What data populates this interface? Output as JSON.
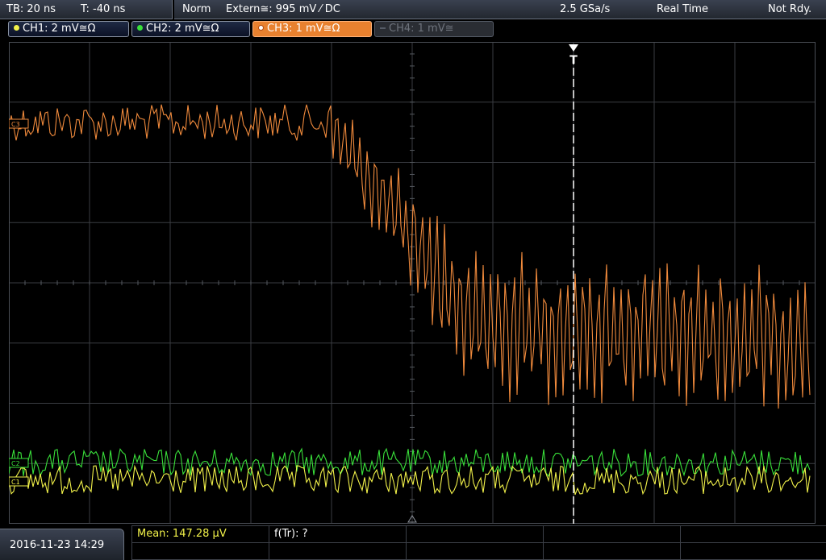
{
  "topbar": {
    "timebase": "TB: 20 ns",
    "trigger_time": "T: -40 ns",
    "mode": "Norm",
    "trigger_source": "Extern≅: 995 mV ⁄ DC",
    "sample_rate": "2.5 GSa/s",
    "acq_mode": "Real Time",
    "status": "Not Rdy."
  },
  "channels": [
    {
      "label": "CH1: 2 mV≅Ω",
      "color": "#f2f24a"
    },
    {
      "label": "CH2: 2 mV≅Ω",
      "color": "#39e03a"
    },
    {
      "label": "CH3: 1 mV≅Ω",
      "color": "#e8812f"
    },
    {
      "label": "CH4: 1 mV≅",
      "color": "#6f747d"
    }
  ],
  "markers": {
    "c3": "C3",
    "c2": "C2",
    "c1": "C1",
    "trigger": "T"
  },
  "bottombar": {
    "datetime": "2016-11-23 14:29",
    "meas1": "Mean: 147.28 µV",
    "meas2": "f(Tr): ?"
  },
  "colors": {
    "ch1": "#f2f24a",
    "ch2": "#39e03a",
    "ch3": "#f08a3c",
    "grid": "#3a3d42",
    "accent_tab": "#e8812f"
  }
}
